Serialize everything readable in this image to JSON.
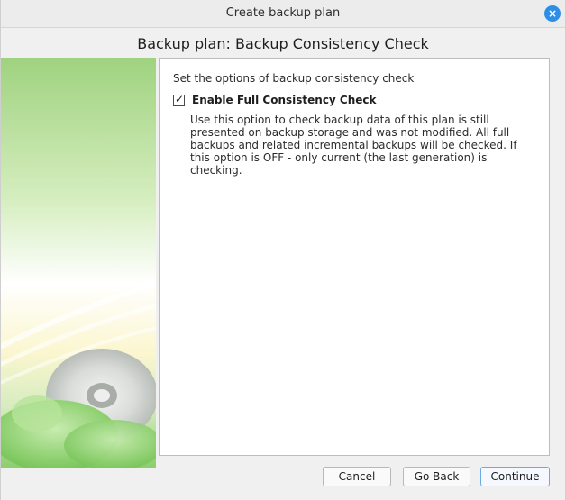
{
  "window": {
    "title": "Create backup plan",
    "close_label": "×"
  },
  "heading": "Backup plan: Backup Consistency Check",
  "panel": {
    "intro": "Set the options of backup consistency check",
    "checkbox_label": "Enable Full Consistency Check",
    "checkbox_checked": true,
    "checkbox_mark": "✓",
    "description": "Use this option to check backup data of this plan is still presented on backup storage and was not modified. All full backups and related incremental backups will be checked. If this option is OFF - only current (the last generation) is checking."
  },
  "buttons": {
    "cancel": "Cancel",
    "back": "Go Back",
    "continue": "Continue"
  },
  "colors": {
    "accent": "#2d8ee8",
    "art_green": "#a8d88a",
    "art_yellow": "#f7f0b0"
  },
  "icons": {
    "close": "close-icon",
    "art": "backup-disc-illustration"
  }
}
